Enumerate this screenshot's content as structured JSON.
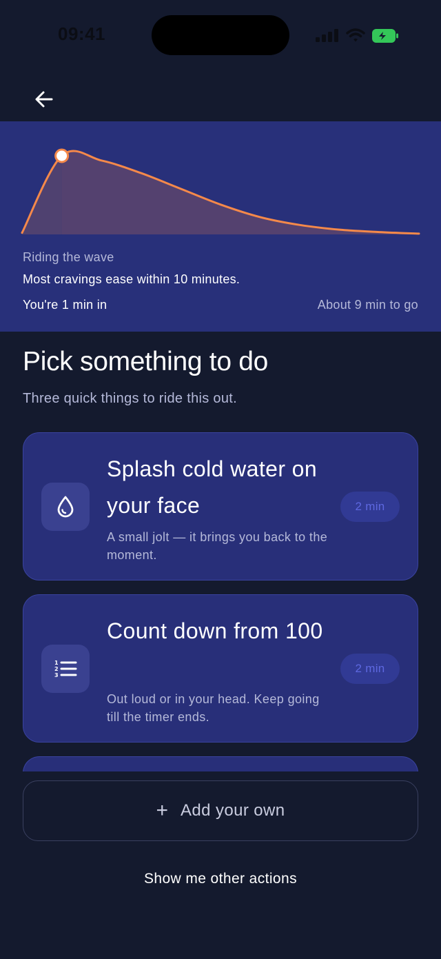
{
  "status_bar": {
    "time": "09:41",
    "icons": [
      "signal-icon",
      "wifi-icon",
      "battery-icon"
    ]
  },
  "header": {
    "back_icon": "arrow-left-icon"
  },
  "wave": {
    "chart_data": {
      "type": "area",
      "x": [
        0,
        1,
        2,
        3,
        4,
        5,
        6,
        7,
        8,
        9,
        10
      ],
      "values": [
        0.02,
        1.0,
        0.94,
        0.78,
        0.58,
        0.38,
        0.22,
        0.12,
        0.06,
        0.03,
        0.01
      ],
      "current_x": 1,
      "xlim": [
        0,
        10
      ],
      "ylim": [
        0,
        1
      ],
      "line_color": "#f5894a",
      "past_fill": "#4f4170",
      "future_fill": "#54416f"
    },
    "eyebrow": "Riding the wave",
    "description": "Most cravings ease within 10 minutes.",
    "elapsed": "You're 1 min in",
    "remaining": "About 9 min to go"
  },
  "section": {
    "title": "Pick something to do",
    "subtitle": "Three quick things to ride this out."
  },
  "actions": [
    {
      "icon": "water-drop-icon",
      "title": "Splash cold water on your face",
      "description": "A small jolt — it brings you back to the moment.",
      "duration": "2 min"
    },
    {
      "icon": "numbered-list-icon",
      "title": "Count down from 100",
      "description": "Out loud or in your head. Keep going till the timer ends.",
      "duration": "2 min"
    }
  ],
  "add_own": {
    "icon": "plus-icon",
    "label": "Add your own"
  },
  "other_actions_label": "Show me other actions",
  "colors": {
    "background": "#141a2e",
    "panel": "#28307a",
    "card": "#282f79",
    "accent": "#f5894a",
    "badge_text": "#5e68e0",
    "battery": "#34c759"
  }
}
